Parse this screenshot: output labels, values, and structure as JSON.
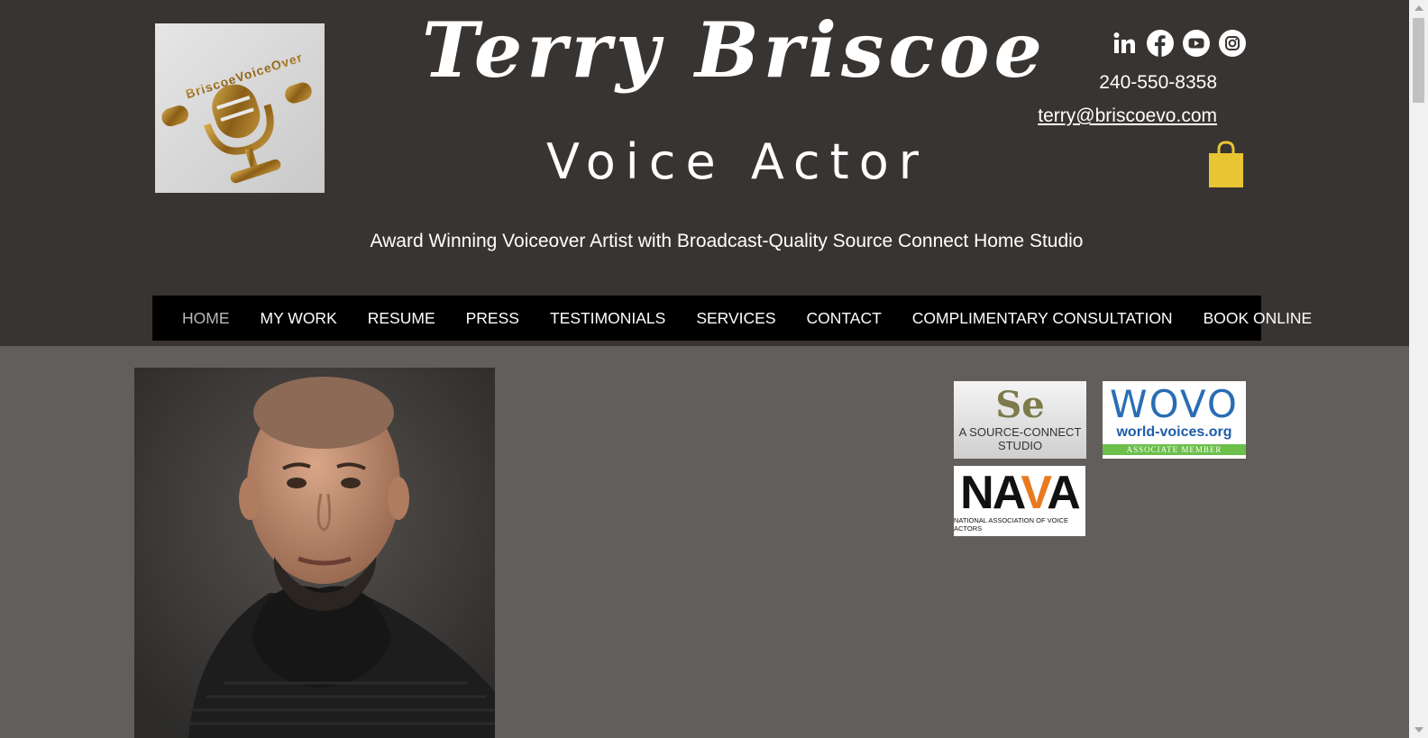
{
  "header": {
    "title": "Terry Briscoe",
    "subtitle": "Voice Actor",
    "tagline": "Award Winning Voiceover Artist with Broadcast-Quality Source Connect Home Studio",
    "logo_text": "BriscoeVoiceOver"
  },
  "contact": {
    "phone": "240-550-8358",
    "email": "terry@briscoevo.com"
  },
  "social": [
    {
      "name": "linkedin-icon"
    },
    {
      "name": "facebook-icon"
    },
    {
      "name": "youtube-icon"
    },
    {
      "name": "instagram-icon"
    }
  ],
  "nav": {
    "items": [
      {
        "label": "HOME"
      },
      {
        "label": "MY WORK"
      },
      {
        "label": "RESUME"
      },
      {
        "label": "PRESS"
      },
      {
        "label": "TESTIMONIALS"
      },
      {
        "label": "SERVICES"
      },
      {
        "label": "CONTACT"
      },
      {
        "label": "COMPLIMENTARY CONSULTATION"
      },
      {
        "label": "BOOK ONLINE"
      }
    ],
    "active": "HOME"
  },
  "badges": {
    "source_connect": {
      "mark": "Se",
      "text": "A SOURCE-CONNECT STUDIO"
    },
    "wovo": {
      "mark": "WOVO",
      "url": "world-voices.org",
      "member": "ASSOCIATE MEMBER"
    },
    "nava": {
      "mark_pre": "NA",
      "mark_v": "V",
      "mark_post": "A",
      "text": "NATIONAL ASSOCIATION OF VOICE ACTORS"
    }
  },
  "colors": {
    "header_bg": "#383432",
    "body_bg": "#625e5c",
    "nav_bg": "#000000",
    "cart": "#e8c532",
    "logo_gold": "#a67c2a"
  }
}
